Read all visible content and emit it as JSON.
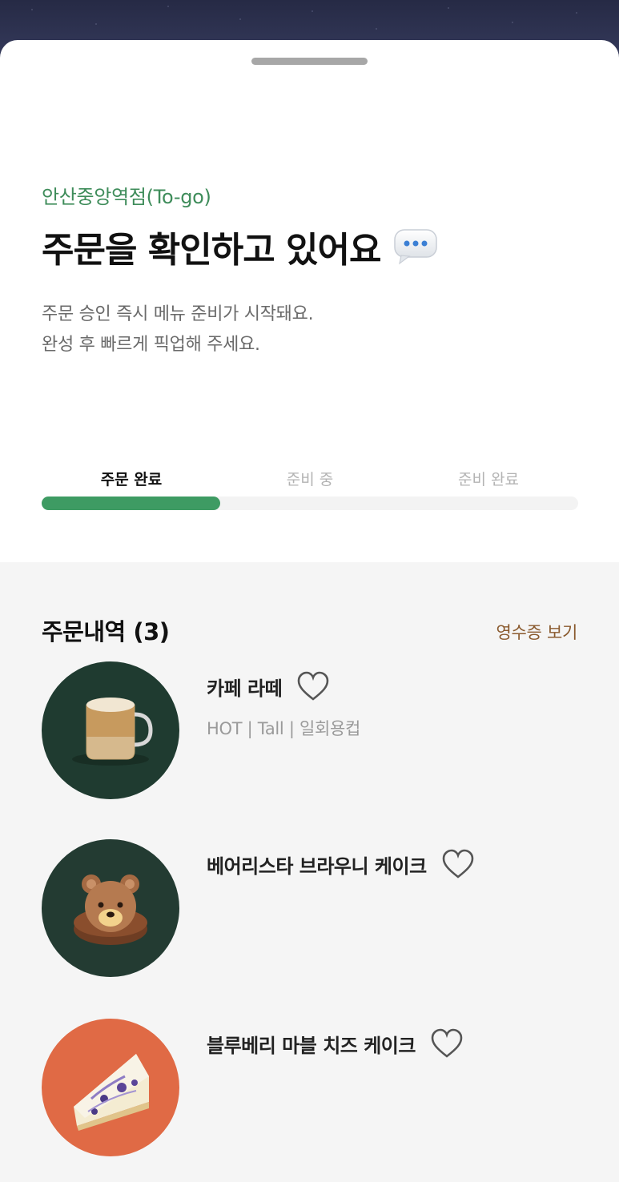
{
  "sheet": {
    "store_name": "안산중앙역점(To-go)",
    "headline": "주문을 확인하고 있어요",
    "headline_icon": "speech-bubble-icon",
    "description_lines": [
      "주문 승인 즉시 메뉴 준비가 시작돼요.",
      "완성 후 빠르게 픽업해 주세요."
    ]
  },
  "progress": {
    "steps": [
      {
        "label": "주문 완료",
        "state": "active"
      },
      {
        "label": "준비 중",
        "state": "inactive"
      },
      {
        "label": "준비 완료",
        "state": "inactive"
      }
    ],
    "fraction": 0.333,
    "fill_color": "#3e9b63"
  },
  "orders": {
    "title": "주문내역 (3)",
    "receipt_link": "영수증 보기",
    "items": [
      {
        "name": "카페 라떼",
        "options": "HOT | Tall | 일회용컵",
        "thumb_color": "#1f3b30",
        "icon": "heart-outline-icon"
      },
      {
        "name": "베어리스타 브라우니 케이크",
        "options": "",
        "thumb_color": "#233b32",
        "icon": "heart-outline-icon"
      },
      {
        "name": "블루베리 마블 치즈 케이크",
        "options": "",
        "thumb_color": "#e06a45",
        "icon": "heart-outline-icon"
      }
    ]
  },
  "colors": {
    "accent_green": "#3e8c5a",
    "receipt_brown": "#8a5a2e",
    "night_sky": "#2d3250"
  }
}
